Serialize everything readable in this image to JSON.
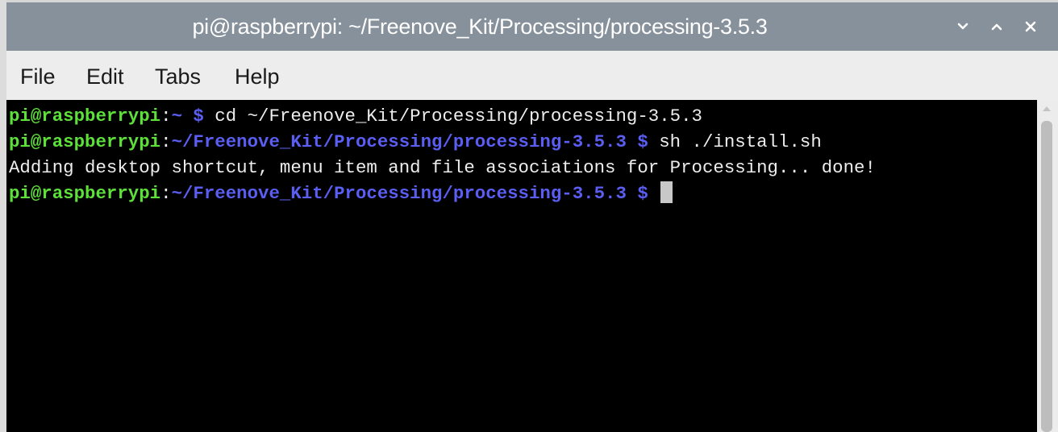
{
  "window": {
    "title": "pi@raspberrypi: ~/Freenove_Kit/Processing/processing-3.5.3",
    "controls": {
      "minimize_icon": "chevron-down-icon",
      "maximize_icon": "chevron-up-icon",
      "close_icon": "close-icon"
    }
  },
  "menu": {
    "items": [
      "File",
      "Edit",
      "Tabs",
      "Help"
    ]
  },
  "terminal": {
    "lines": [
      {
        "user": "pi@raspberrypi",
        "colon": ":",
        "path": "~ $",
        "command": " cd ~/Freenove_Kit/Processing/processing-3.5.3"
      },
      {
        "user": "pi@raspberrypi",
        "colon": ":",
        "path": "~/Freenove_Kit/Processing/processing-3.5.3 $",
        "command": " sh ./install.sh"
      },
      {
        "output": "Adding desktop shortcut, menu item and file associations for Processing... done!"
      },
      {
        "user": "pi@raspberrypi",
        "colon": ":",
        "path": "~/Freenove_Kit/Processing/processing-3.5.3 $",
        "command": " "
      }
    ]
  },
  "colors": {
    "titlebar": "#87919b",
    "menubar": "#ededed",
    "terminal_bg": "#000000",
    "prompt_user": "#5de03a",
    "prompt_path": "#5a5ef2",
    "text": "#ededed"
  }
}
